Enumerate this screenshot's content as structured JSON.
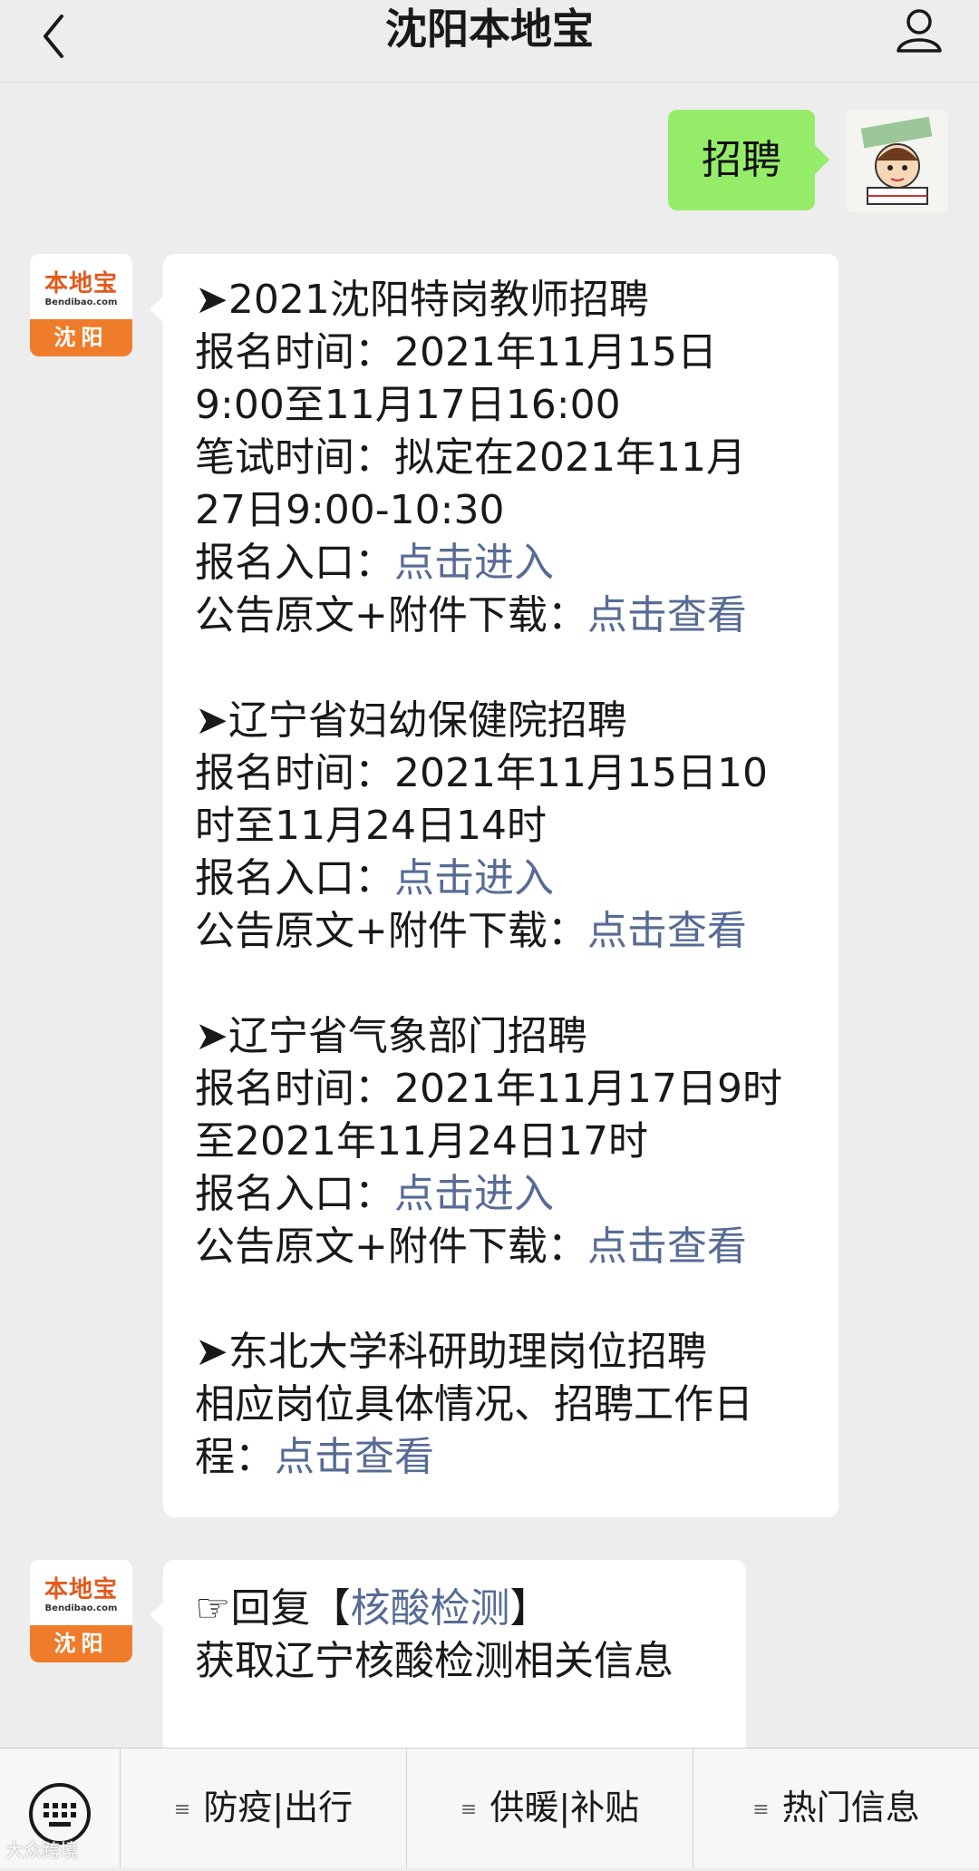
{
  "header": {
    "title": "沈阳本地宝"
  },
  "sent": {
    "text": "招聘"
  },
  "bot": {
    "logo_text": "本地宝",
    "logo_sub": "Bendibao.com",
    "city": "沈阳"
  },
  "message1": {
    "sections": [
      {
        "title": "➤2021沈阳特岗教师招聘",
        "lines": [
          "报名时间：2021年11月15日",
          "9:00至11月17日16:00",
          "笔试时间：拟定在2021年11月",
          "27日9:00-10:30"
        ],
        "entry_label": "报名入口：",
        "entry_link": "点击进入",
        "notice_label": "公告原文+附件下载：",
        "notice_link": "点击查看"
      },
      {
        "title": "➤辽宁省妇幼保健院招聘",
        "lines": [
          "报名时间：2021年11月15日10",
          "时至11月24日14时"
        ],
        "entry_label": "报名入口：",
        "entry_link": "点击进入",
        "notice_label": "公告原文+附件下载：",
        "notice_link": "点击查看"
      },
      {
        "title": "➤辽宁省气象部门招聘",
        "lines": [
          "报名时间：2021年11月17日9时",
          "至2021年11月24日17时"
        ],
        "entry_label": "报名入口：",
        "entry_link": "点击进入",
        "notice_label": "公告原文+附件下载：",
        "notice_link": "点击查看"
      },
      {
        "title": "➤东北大学科研助理岗位招聘",
        "lines": [
          "相应岗位具体情况、招聘工作日"
        ],
        "tail_label": "程：",
        "tail_link": "点击查看"
      }
    ]
  },
  "message2": {
    "prefix": "☞回复【",
    "keyword": "核酸检测",
    "suffix": "】",
    "line2": "获取辽宁核酸检测相关信息"
  },
  "menu": {
    "items": [
      "防疫|出行",
      "供暖|补贴",
      "热门信息"
    ]
  },
  "watermark": "大众跨境"
}
